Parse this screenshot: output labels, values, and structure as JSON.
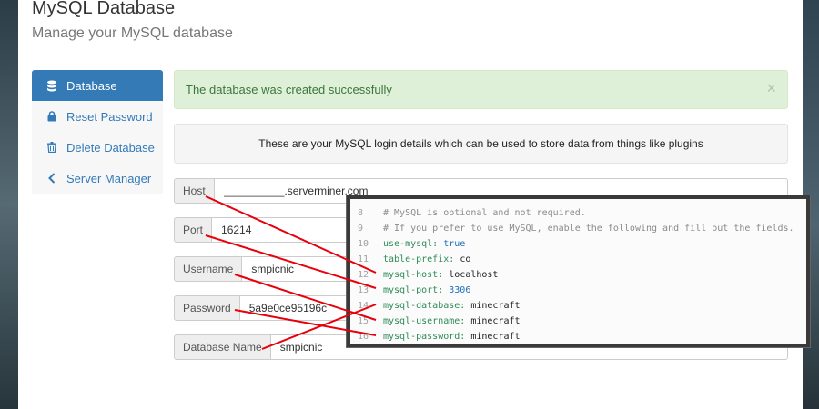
{
  "header": {
    "title": "MySQL Database",
    "subtitle": "Manage your MySQL database"
  },
  "sidebar": {
    "items": [
      {
        "label": "Database",
        "icon": "database-icon",
        "active": true
      },
      {
        "label": "Reset Password",
        "icon": "lock-icon",
        "active": false
      },
      {
        "label": "Delete Database",
        "icon": "trash-icon",
        "active": false
      },
      {
        "label": "Server Manager",
        "icon": "chevron-left-icon",
        "active": false
      }
    ]
  },
  "alert": {
    "message": "The database was created successfully",
    "close_label": "×"
  },
  "info": {
    "text": "These are your MySQL login details which can be used to store data from things like plugins"
  },
  "fields": [
    {
      "label": "Host",
      "value": "__________.serverminer.com"
    },
    {
      "label": "Port",
      "value": "16214"
    },
    {
      "label": "Username",
      "value": "smpicnic"
    },
    {
      "label": "Password",
      "value": "5a9e0ce95196c"
    },
    {
      "label": "Database Name",
      "value": "smpicnic"
    }
  ],
  "code": {
    "lines": [
      {
        "num": "8",
        "text": "# MySQL is optional and not required."
      },
      {
        "num": "9",
        "text": "# If you prefer to use MySQL, enable the following and fill out the fields."
      },
      {
        "num": "10",
        "key": "use-mysql:",
        "value": "true"
      },
      {
        "num": "11",
        "key": "table-prefix:",
        "value": "co_"
      },
      {
        "num": "12",
        "key": "mysql-host:",
        "value": "localhost"
      },
      {
        "num": "13",
        "key": "mysql-port:",
        "value": "3306"
      },
      {
        "num": "14",
        "key": "mysql-database:",
        "value": "minecraft"
      },
      {
        "num": "15",
        "key": "mysql-username:",
        "value": "minecraft"
      },
      {
        "num": "16",
        "key": "mysql-password:",
        "value": "minecraft"
      }
    ]
  },
  "colors": {
    "primary": "#337ab7",
    "success_bg": "#dff0d8",
    "success_text": "#3c763d",
    "annotation_line": "#e8000b"
  }
}
